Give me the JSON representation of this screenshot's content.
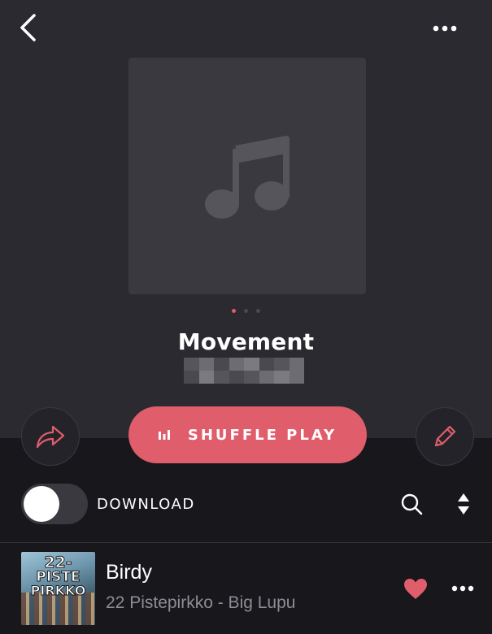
{
  "header": {
    "back_icon": "chevron-left-icon",
    "more_icon": "more-horizontal-icon"
  },
  "playlist": {
    "artwork_icon": "music-note-icon",
    "title": "Movement",
    "owner_name": "",
    "page_dots": 3,
    "active_dot": 0
  },
  "actions": {
    "share_icon": "share-arrow-icon",
    "shuffle_label": "SHUFFLE PLAY",
    "shuffle_icon": "equalizer-bars-icon",
    "edit_icon": "pencil-icon"
  },
  "toolbar": {
    "download_label": "DOWNLOAD",
    "download_enabled": false,
    "search_icon": "search-icon",
    "sort_icon": "sort-updown-icon"
  },
  "tracks": [
    {
      "title": "Birdy",
      "subtitle": "22 Pistepirkko - Big Lupu",
      "art_lines": [
        "22-",
        "PISTE",
        "PIRKKO"
      ],
      "liked": true,
      "like_icon": "heart-icon",
      "more_icon": "more-horizontal-icon"
    }
  ],
  "colors": {
    "accent": "#e05d6c",
    "header_bg": "#2b2a30",
    "body_bg": "#18171c",
    "secondary_text": "#8e8d93"
  }
}
